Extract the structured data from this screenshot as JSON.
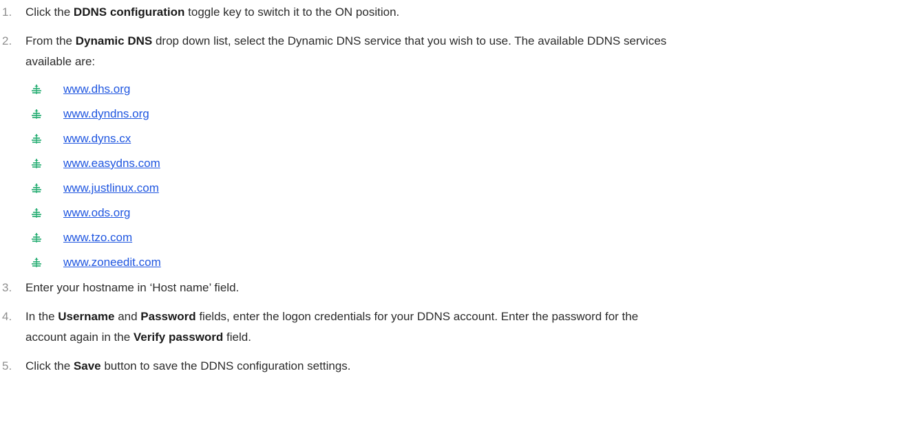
{
  "steps": [
    {
      "number": "1.",
      "parts": [
        "Click the ",
        "DDNS configuration",
        " toggle key to switch it to the ON position."
      ]
    },
    {
      "number": "2.",
      "parts": [
        "From the ",
        "Dynamic DNS",
        " drop down list, select the Dynamic DNS service that you wish to use. The available DDNS services",
        "available are:"
      ]
    },
    {
      "number": "3.",
      "parts": [
        "Enter your hostname in ‘Host name’ field."
      ]
    },
    {
      "number": "4.",
      "parts": [
        "In the ",
        "Username",
        " and ",
        "Password",
        " fields, enter the logon credentials for your DDNS account. Enter the password for the",
        "account again in the ",
        "Verify password",
        " field."
      ]
    },
    {
      "number": "5.",
      "parts": [
        "Click the ",
        "Save",
        " button to save the DDNS configuration settings."
      ]
    }
  ],
  "services": [
    "www.dhs.org",
    "www.dyndns.org",
    "www.dyns.cx",
    "www.easydns.com",
    "www.justlinux.com",
    "www.ods.org",
    "www.tzo.com",
    "www.zoneedit.com"
  ],
  "colors": {
    "number": "#8f8f8f",
    "link": "#1f56e0",
    "bullet": "#1aa86b"
  },
  "bullet_icon": "signal-bullet-icon"
}
